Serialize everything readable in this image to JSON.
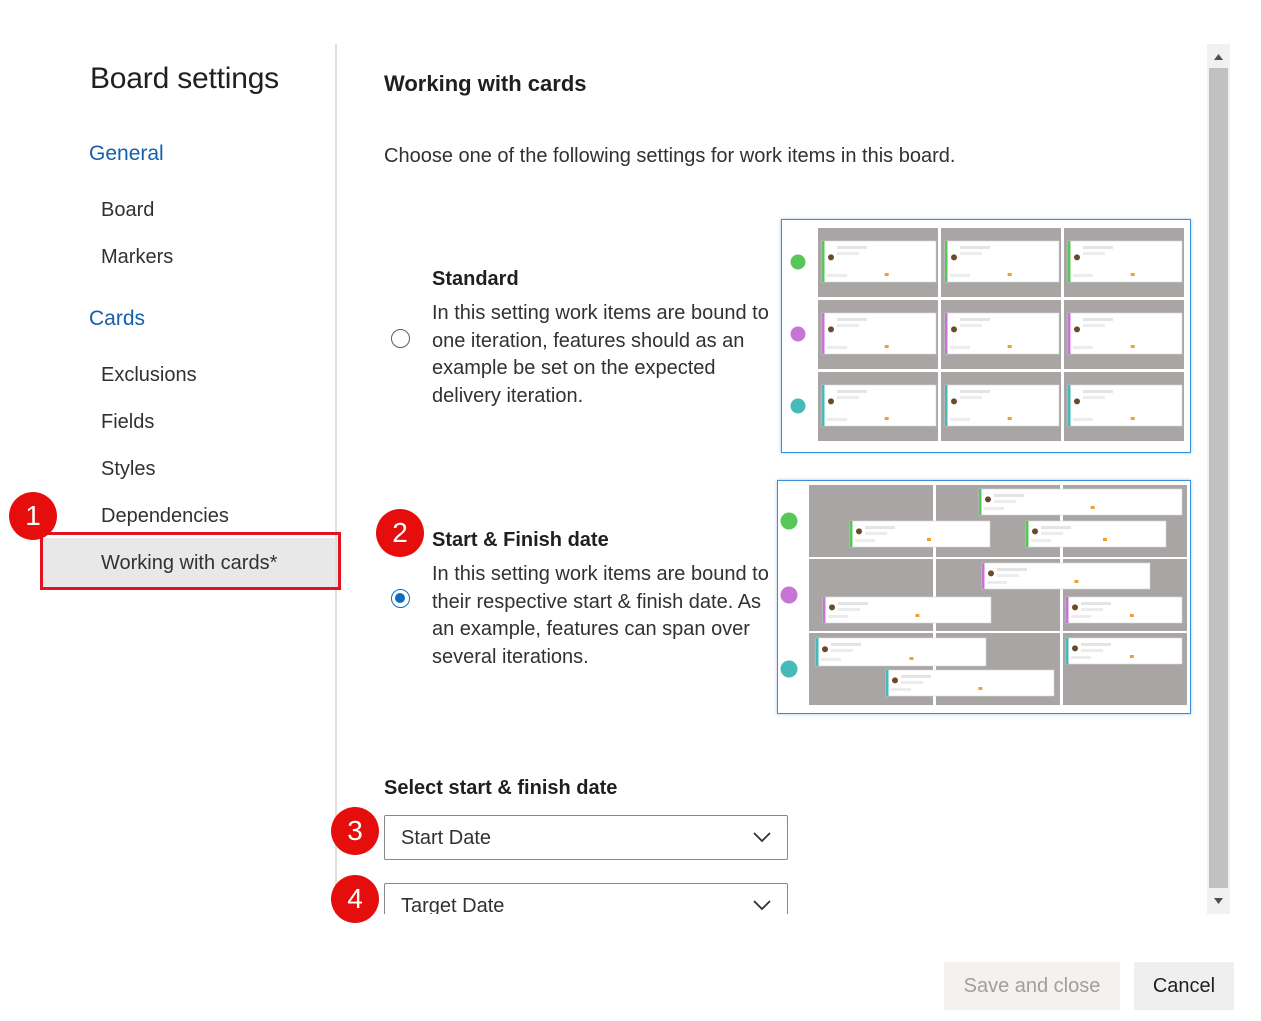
{
  "nav": {
    "title": "Board settings",
    "groups": [
      {
        "label": "General",
        "items": [
          "Board",
          "Markers"
        ]
      },
      {
        "label": "Cards",
        "items": [
          "Exclusions",
          "Fields",
          "Styles",
          "Dependencies",
          "Working with cards*"
        ]
      }
    ],
    "selected_item": "Working with cards*"
  },
  "callouts": [
    "1",
    "2",
    "3",
    "4"
  ],
  "content": {
    "title": "Working with cards",
    "intro": "Choose one of the following settings for work items in this board.",
    "options": [
      {
        "title": "Standard",
        "description": "In this setting work items are bound to one iteration, features should as an example be set on the expected delivery iteration.",
        "selected": false
      },
      {
        "title": "Start & Finish date",
        "description": "In this setting work items are bound to their respective start & finish date. As an example, features can span over several iterations.",
        "selected": true
      }
    ],
    "date_section_label": "Select start & finish date",
    "start_date_value": "Start Date",
    "target_date_value": "Target Date"
  },
  "footer": {
    "save_label": "Save and close",
    "cancel_label": "Cancel"
  },
  "colors": {
    "accent": "#0f6cbd",
    "link_blue": "#1460aa",
    "callout_red": "#e60d0d",
    "row_green": "#58c75a",
    "row_purple": "#c874d6",
    "row_teal": "#46b9b9",
    "lane_gray": "#a8a5a4"
  }
}
